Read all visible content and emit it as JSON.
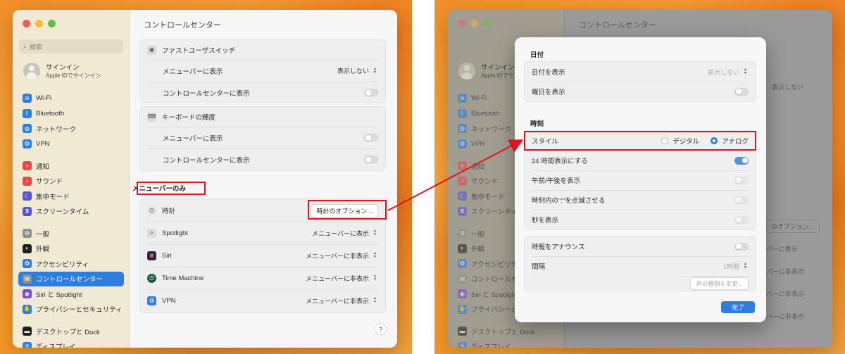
{
  "left": {
    "sidebar": {
      "search_placeholder": "検索",
      "account": {
        "name": "サインイン",
        "sub": "Apple IDでサインイン"
      },
      "groups": [
        [
          {
            "label": "Wi-Fi",
            "icon": "wifi-icon",
            "color": "#2f7ddf",
            "glyph": "≋"
          },
          {
            "label": "Bluetooth",
            "icon": "bluetooth-icon",
            "color": "#2f7ddf",
            "glyph": "ᛒ"
          },
          {
            "label": "ネットワーク",
            "icon": "network-icon",
            "color": "#2f7ddf",
            "glyph": "◍"
          },
          {
            "label": "VPN",
            "icon": "vpn-icon",
            "color": "#2f7ddf",
            "glyph": "◍"
          }
        ],
        [
          {
            "label": "通知",
            "icon": "notification-icon",
            "color": "#e54b4b",
            "glyph": "▪"
          },
          {
            "label": "サウンド",
            "icon": "sound-icon",
            "color": "#e54b4b",
            "glyph": "♪"
          },
          {
            "label": "集中モード",
            "icon": "focus-moon-icon",
            "color": "#5b54c9",
            "glyph": "☾"
          },
          {
            "label": "スクリーンタイム",
            "icon": "hourglass-icon",
            "color": "#5b54c9",
            "glyph": "⧗"
          }
        ],
        [
          {
            "label": "一般",
            "icon": "gear-icon",
            "color": "#8e8e8e",
            "glyph": "⚙"
          },
          {
            "label": "外観",
            "icon": "appearance-icon",
            "color": "#1f1f1f",
            "glyph": "◐"
          },
          {
            "label": "アクセシビリティ",
            "icon": "accessibility-icon",
            "color": "#2f7ddf",
            "glyph": "✪"
          },
          {
            "label": "コントロールセンター",
            "icon": "control-center-icon",
            "color": "#8e8e8e",
            "glyph": "▤",
            "active": true
          },
          {
            "label": "Siri と Spotlight",
            "icon": "siri-icon",
            "color": "#7a4ad1",
            "glyph": "◉"
          },
          {
            "label": "プライバシーとセキュリティ",
            "icon": "privacy-hand-icon",
            "color": "#2f7ddf",
            "glyph": "✋"
          }
        ],
        [
          {
            "label": "デスクトップと Dock",
            "icon": "desktop-dock-icon",
            "color": "#1f1f1f",
            "glyph": "▬"
          },
          {
            "label": "ディスプレイ",
            "icon": "display-icon",
            "color": "#2f7ddf",
            "glyph": "☀"
          }
        ]
      ]
    },
    "title": "コントロールセンター",
    "fast_user": {
      "label": "ファストユーザスイッチ",
      "rows": [
        {
          "label": "メニューバーに表示",
          "value": "表示しない"
        },
        {
          "label": "コントロールセンターに表示",
          "toggle": false
        }
      ]
    },
    "keyboard": {
      "label": "キーボードの輝度",
      "rows": [
        {
          "label": "メニューバーに表示",
          "toggle": false
        },
        {
          "label": "コントロールセンターに表示",
          "toggle": false
        }
      ]
    },
    "menubar_only_label": "メニューバーのみ",
    "menubar_only": [
      {
        "label": "時計",
        "icon": "clock-icon",
        "button": "時計のオプション..."
      },
      {
        "label": "Spotlight",
        "icon": "search-icon",
        "value": "メニューバーに表示"
      },
      {
        "label": "Siri",
        "icon": "siri-icon",
        "value": "メニューバーに非表示"
      },
      {
        "label": "Time Machine",
        "icon": "time-machine-icon",
        "value": "メニューバーに非表示"
      },
      {
        "label": "VPN",
        "icon": "vpn-icon",
        "value": "メニューバーに非表示"
      }
    ],
    "help": "?"
  },
  "right": {
    "sheet": {
      "date_header": "日付",
      "date_rows": [
        {
          "label": "日付を表示",
          "value": "表示しない"
        },
        {
          "label": "曜日を表示",
          "toggle": false
        }
      ],
      "time_header": "時刻",
      "style": {
        "label": "スタイル",
        "options": [
          "デジタル",
          "アナログ"
        ],
        "selected": "アナログ"
      },
      "time_rows": [
        {
          "label": "24 時間表示にする",
          "toggle": true
        },
        {
          "label": "午前/午後を表示",
          "toggle": false
        },
        {
          "label": "時刻内の\":\"を点滅させる",
          "toggle": false
        },
        {
          "label": "秒を表示",
          "toggle": false
        }
      ],
      "announce": {
        "label": "時報をアナウンス",
        "toggle": false
      },
      "interval": {
        "label": "間隔",
        "value": "1時間"
      },
      "voice_button": "声の種類を変更...",
      "done": "完了"
    },
    "bg": {
      "title": "コントロールセンター",
      "signin": "サインイン",
      "signin_sub": "Apple IDでサ",
      "items": [
        "Wi-Fi",
        "Bluetooth",
        "ネットワーク",
        "VPN",
        "通知",
        "サウンド",
        "集中モード",
        "スクリーンタイム",
        "一般",
        "外観",
        "アクセシビリティ",
        "コントロールセンター",
        "Siri と Spotlight",
        "プライバシーと",
        "デスクトップと Dock",
        "ディスプレイ"
      ],
      "value1": "表示しない",
      "option_button": "のオプション...",
      "values": [
        "バーに表示",
        "バーに非表示",
        "バーに非表示",
        "バーに非表示"
      ]
    }
  }
}
